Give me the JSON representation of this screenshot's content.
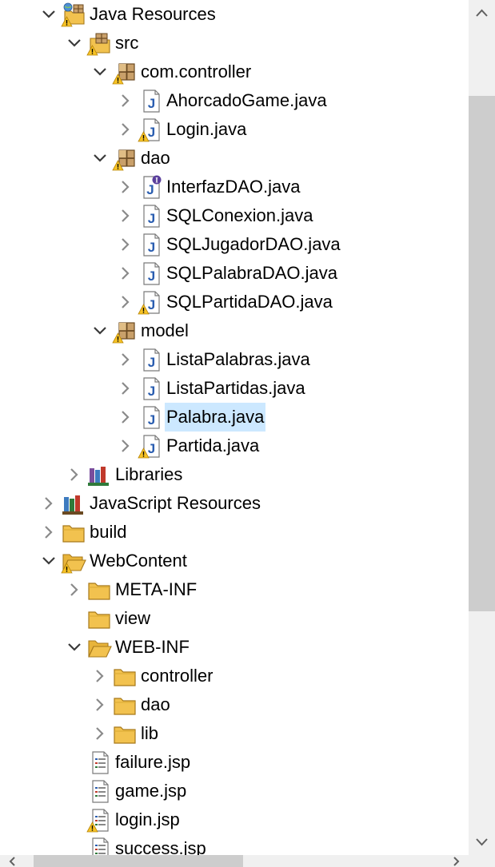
{
  "tree": {
    "items": [
      {
        "depth": 0,
        "twisty": "expanded",
        "icon": "java-resources-icon",
        "warn": true,
        "label": "Java Resources"
      },
      {
        "depth": 1,
        "twisty": "expanded",
        "icon": "source-folder-icon",
        "warn": true,
        "label": "src"
      },
      {
        "depth": 2,
        "twisty": "expanded",
        "icon": "package-icon",
        "warn": true,
        "label": "com.controller"
      },
      {
        "depth": 3,
        "twisty": "collapsed",
        "icon": "java-file-icon",
        "warn": false,
        "label": "AhorcadoGame.java"
      },
      {
        "depth": 3,
        "twisty": "collapsed",
        "icon": "java-file-icon",
        "warn": true,
        "label": "Login.java"
      },
      {
        "depth": 2,
        "twisty": "expanded",
        "icon": "package-icon",
        "warn": true,
        "label": "dao"
      },
      {
        "depth": 3,
        "twisty": "collapsed",
        "icon": "java-interface-file-icon",
        "warn": false,
        "label": "InterfazDAO.java"
      },
      {
        "depth": 3,
        "twisty": "collapsed",
        "icon": "java-file-icon",
        "warn": false,
        "label": "SQLConexion.java"
      },
      {
        "depth": 3,
        "twisty": "collapsed",
        "icon": "java-file-icon",
        "warn": false,
        "label": "SQLJugadorDAO.java"
      },
      {
        "depth": 3,
        "twisty": "collapsed",
        "icon": "java-file-icon",
        "warn": false,
        "label": "SQLPalabraDAO.java"
      },
      {
        "depth": 3,
        "twisty": "collapsed",
        "icon": "java-file-icon",
        "warn": true,
        "label": "SQLPartidaDAO.java"
      },
      {
        "depth": 2,
        "twisty": "expanded",
        "icon": "package-icon",
        "warn": true,
        "label": "model"
      },
      {
        "depth": 3,
        "twisty": "collapsed",
        "icon": "java-file-icon",
        "warn": false,
        "label": "ListaPalabras.java"
      },
      {
        "depth": 3,
        "twisty": "collapsed",
        "icon": "java-file-icon",
        "warn": false,
        "label": "ListaPartidas.java"
      },
      {
        "depth": 3,
        "twisty": "collapsed",
        "icon": "java-file-icon",
        "warn": false,
        "label": "Palabra.java",
        "selected": true
      },
      {
        "depth": 3,
        "twisty": "collapsed",
        "icon": "java-file-icon",
        "warn": true,
        "label": "Partida.java"
      },
      {
        "depth": 1,
        "twisty": "collapsed",
        "icon": "libraries-icon",
        "warn": false,
        "label": "Libraries"
      },
      {
        "depth": 0,
        "twisty": "collapsed",
        "icon": "javascript-resources-icon",
        "warn": false,
        "label": "JavaScript Resources"
      },
      {
        "depth": 0,
        "twisty": "collapsed",
        "icon": "folder-icon",
        "warn": false,
        "label": "build"
      },
      {
        "depth": 0,
        "twisty": "expanded",
        "icon": "folder-open-icon",
        "warn": true,
        "label": "WebContent"
      },
      {
        "depth": 1,
        "twisty": "collapsed",
        "icon": "folder-icon",
        "warn": false,
        "label": "META-INF"
      },
      {
        "depth": 1,
        "twisty": "none",
        "icon": "folder-icon",
        "warn": false,
        "label": "view"
      },
      {
        "depth": 1,
        "twisty": "expanded",
        "icon": "folder-open-icon",
        "warn": false,
        "label": "WEB-INF"
      },
      {
        "depth": 2,
        "twisty": "collapsed",
        "icon": "folder-icon",
        "warn": false,
        "label": "controller"
      },
      {
        "depth": 2,
        "twisty": "collapsed",
        "icon": "folder-icon",
        "warn": false,
        "label": "dao"
      },
      {
        "depth": 2,
        "twisty": "collapsed",
        "icon": "folder-icon",
        "warn": false,
        "label": "lib"
      },
      {
        "depth": 1,
        "twisty": "none",
        "icon": "jsp-file-icon",
        "warn": false,
        "label": "failure.jsp"
      },
      {
        "depth": 1,
        "twisty": "none",
        "icon": "jsp-file-icon",
        "warn": false,
        "label": "game.jsp"
      },
      {
        "depth": 1,
        "twisty": "none",
        "icon": "jsp-file-icon",
        "warn": true,
        "label": "login.jsp"
      },
      {
        "depth": 1,
        "twisty": "none",
        "icon": "jsp-file-icon",
        "warn": false,
        "label": "success.jsp"
      }
    ]
  },
  "colors": {
    "selection": "#cce8ff",
    "scrollbar_track": "#f0f0f0",
    "scrollbar_thumb": "#cdcdcd",
    "folder": "#f2c24f",
    "java_blue": "#2a5db0",
    "warning": "#f7c325"
  }
}
